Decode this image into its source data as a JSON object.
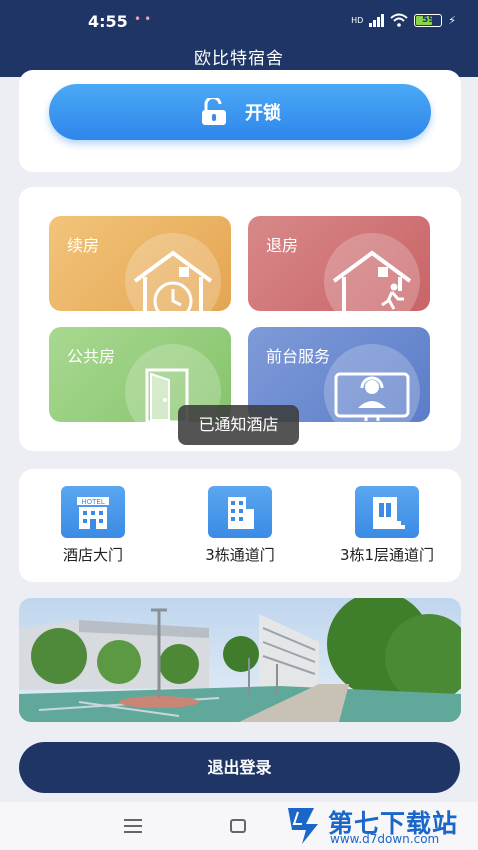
{
  "status_bar": {
    "time": "4:55",
    "dots": "••",
    "network": "HD",
    "battery": "59"
  },
  "header": {
    "title": "欧比特宿舍"
  },
  "unlock": {
    "label": "开锁",
    "icon": "unlock-icon"
  },
  "services": [
    {
      "label": "续房",
      "icon": "house-clock-icon",
      "color": "#e9ae60"
    },
    {
      "label": "退房",
      "icon": "house-exit-icon",
      "color": "#cf7173"
    },
    {
      "label": "公共房",
      "icon": "door-icon",
      "color": "#93cc7a"
    },
    {
      "label": "前台服务",
      "icon": "headset-agent-icon",
      "color": "#6a89cf"
    }
  ],
  "toast": {
    "text": "已通知酒店"
  },
  "doors": [
    {
      "label": "酒店大门",
      "icon": "hotel-icon"
    },
    {
      "label": "3栋通道门",
      "icon": "building-icon"
    },
    {
      "label": "3栋1层通道门",
      "icon": "building-door-icon"
    }
  ],
  "photo": {
    "hotel_sign": "HOTEL"
  },
  "logout": {
    "label": "退出登录"
  },
  "watermark": {
    "title": "第七下载站",
    "url": "www.d7down.com"
  },
  "colors": {
    "header": "#1e3566",
    "accent": "#2f86ea",
    "background": "#eceef4"
  }
}
